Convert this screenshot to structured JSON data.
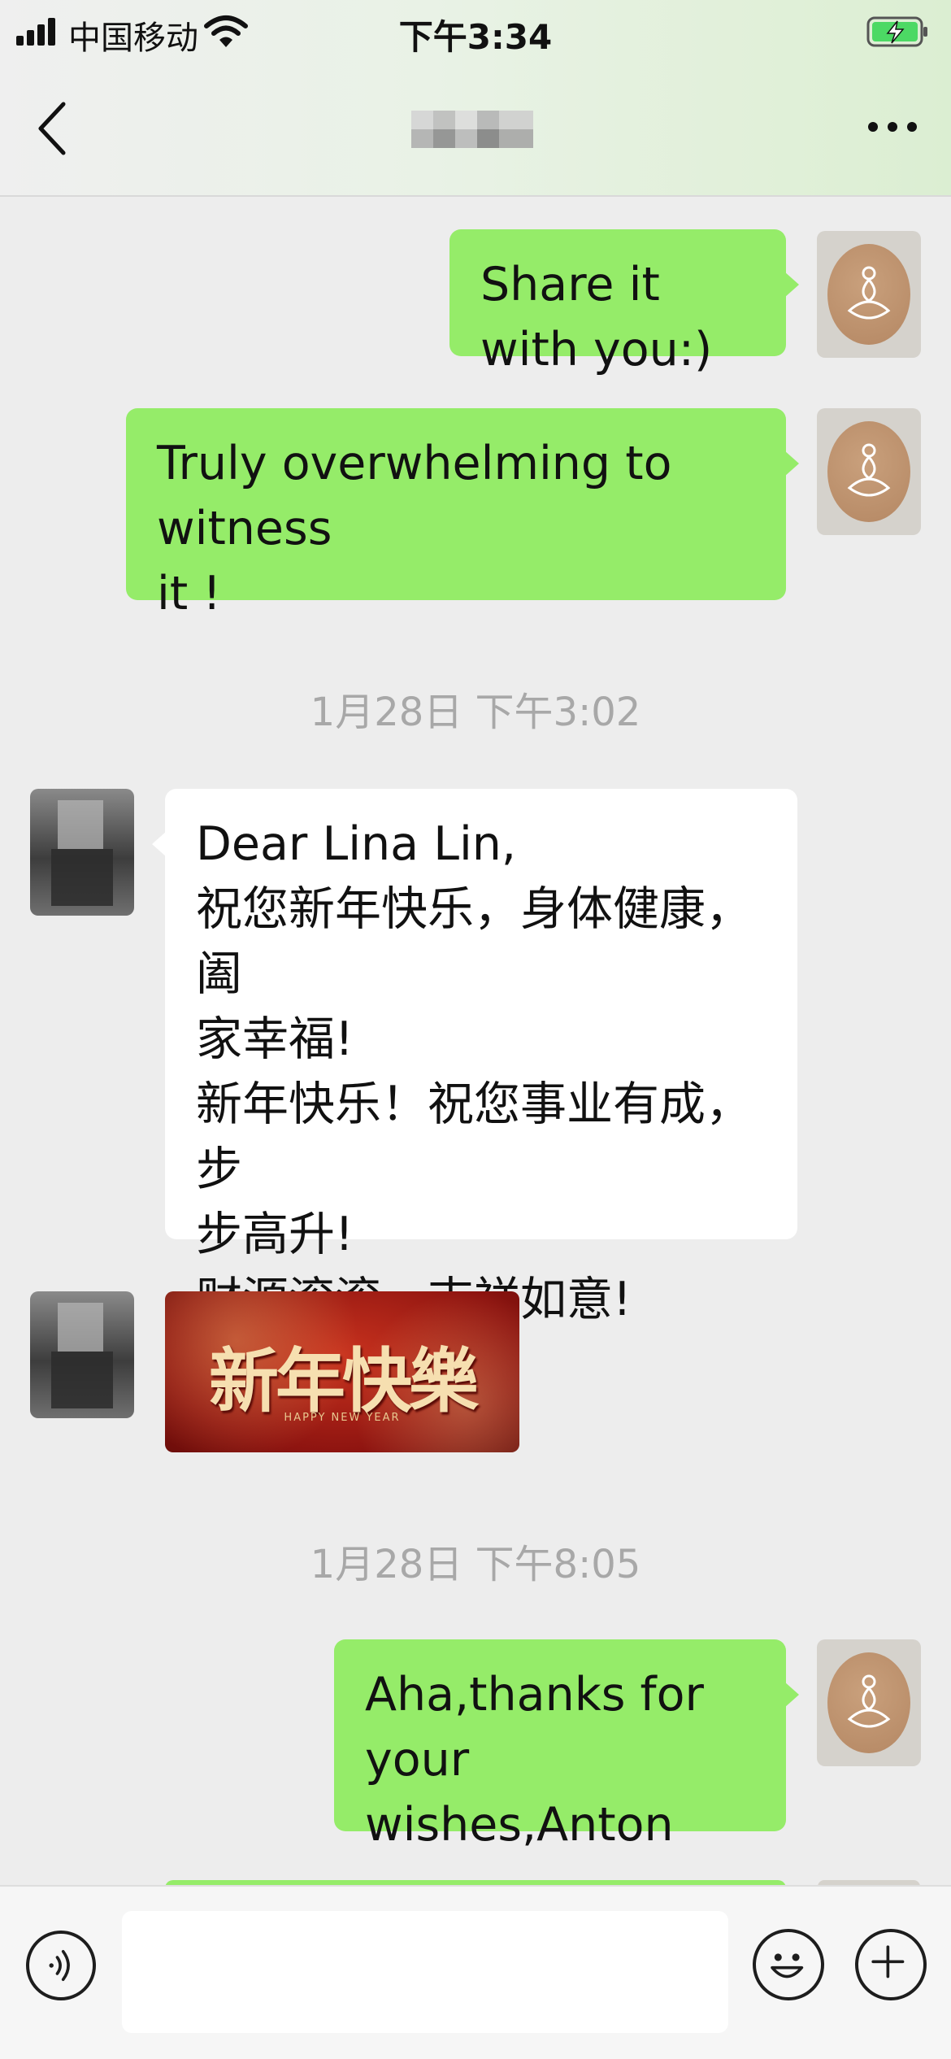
{
  "status_bar": {
    "carrier": "中国移动",
    "time": "下午3:34"
  },
  "nav": {
    "back_icon": "chevron-left-icon",
    "title": "",
    "more_icon": "ellipsis-icon"
  },
  "messages": [
    {
      "sender": "me",
      "lines": [
        "Share it with you:)"
      ]
    },
    {
      "sender": "me",
      "lines": [
        "Truly overwhelming to witness",
        "it !"
      ]
    },
    {
      "timestamp": "1月28日 下午3:02"
    },
    {
      "sender": "other",
      "lines": [
        "Dear Lina Lin,",
        "祝您新年快乐，身体健康，阖",
        "家幸福!",
        "新年快乐！祝您事业有成，步",
        "步高升!",
        "财源滚滚，吉祥如意!"
      ]
    },
    {
      "sender": "other",
      "sticker": {
        "text": "新年快樂",
        "subtext": "HAPPY NEW YEAR"
      }
    },
    {
      "timestamp": "1月28日 下午8:05"
    },
    {
      "sender": "me",
      "lines": [
        "Aha,thanks for your",
        "wishes,Anton"
      ]
    }
  ],
  "input_bar": {
    "voice_icon": "voice-icon",
    "text_value": "",
    "emoji_icon": "emoji-icon",
    "add_icon": "plus-icon"
  },
  "colors": {
    "my_bubble": "#95ec69",
    "their_bubble": "#ffffff",
    "background": "#ededed",
    "timestamp": "#a8a8a8"
  }
}
